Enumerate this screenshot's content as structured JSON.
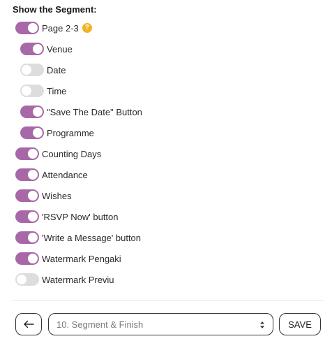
{
  "heading": "Show the Segment:",
  "toggles": [
    {
      "label": "Page 2-3",
      "on": true,
      "help_icon": "question-icon",
      "help_glyph": "?"
    },
    {
      "label": "Venue",
      "on": true
    },
    {
      "label": "Date",
      "on": false
    },
    {
      "label": "Time",
      "on": false
    },
    {
      "label": "\"Save The Date\" Button",
      "on": true
    },
    {
      "label": "Programme",
      "on": true
    },
    {
      "label": "Counting Days",
      "on": true
    },
    {
      "label": "Attendance",
      "on": true
    },
    {
      "label": "Wishes",
      "on": true
    },
    {
      "label": "'RSVP Now' button",
      "on": true
    },
    {
      "label": "'Write a Message' button",
      "on": true
    },
    {
      "label": "Watermark Pengaki",
      "on": true
    },
    {
      "label": "Watermark Previu",
      "on": false
    }
  ],
  "footer": {
    "back_icon": "arrow-left-icon",
    "select_value": "10. Segment & Finish",
    "select_icon": "up-down-arrows-icon",
    "save_label": "SAVE"
  },
  "colors": {
    "toggle_on": "#a868a8",
    "toggle_off": "#dddddd",
    "help_icon": "#f0b323"
  }
}
